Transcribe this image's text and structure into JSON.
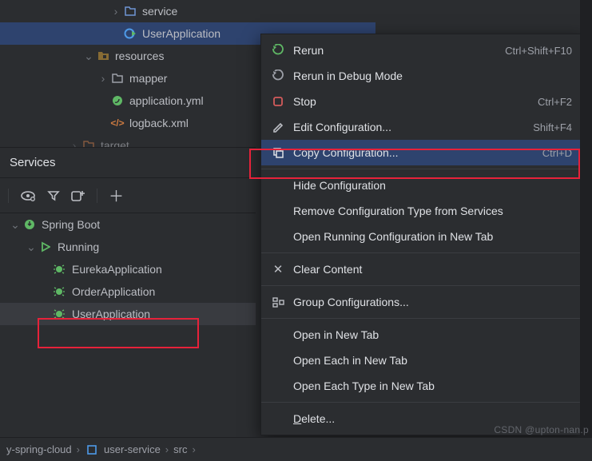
{
  "project_tree": {
    "service_label": "service",
    "user_app": "UserApplication",
    "resources": "resources",
    "mapper": "mapper",
    "app_yml": "application.yml",
    "logback": "logback.xml",
    "target": "target"
  },
  "services": {
    "title": "Services",
    "root": "Spring Boot",
    "running": "Running",
    "apps": [
      "EurekaApplication",
      "OrderApplication",
      "UserApplication"
    ]
  },
  "menu": {
    "rerun": "Rerun",
    "rerun_sc": "Ctrl+Shift+F10",
    "rerun_debug": "Rerun in Debug Mode",
    "stop": "Stop",
    "stop_sc": "Ctrl+F2",
    "edit_cfg": "Edit Configuration...",
    "edit_cfg_sc": "Shift+F4",
    "copy_cfg": "Copy Configuration...",
    "copy_cfg_sc": "Ctrl+D",
    "hide_cfg": "Hide Configuration",
    "remove_type": "Remove Configuration Type from Services",
    "open_new_tab": "Open Running Configuration in New Tab",
    "clear": "Clear Content",
    "group_cfg": "Group Configurations...",
    "open_tab": "Open in New Tab",
    "open_each": "Open Each in New Tab",
    "open_each_type": "Open Each Type in New Tab",
    "delete": "Delete..."
  },
  "breadcrumb": {
    "a": "y-spring-cloud",
    "b": "user-service",
    "c": "src"
  },
  "watermark": "CSDN @upton-nan.p"
}
